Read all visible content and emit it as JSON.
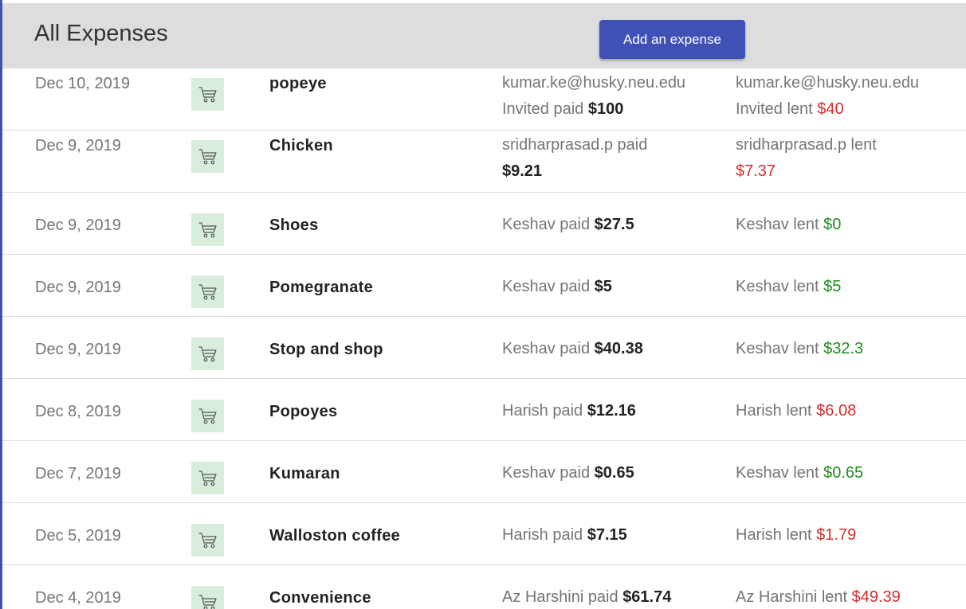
{
  "header": {
    "title": "All Expenses",
    "add_button_label": "Add an expense"
  },
  "colors": {
    "accent": "#3f51b5",
    "header_bg": "#dddddd",
    "icon_bg": "#d9eddd",
    "negative": "#d32f2f",
    "positive": "#1e8e1e"
  },
  "expenses": [
    {
      "date": "Dec 10, 2019",
      "icon": "shopping-cart-icon",
      "description": "popeye",
      "paid_line1": "kumar.ke@husky.neu.edu",
      "paid_prefix": "Invited paid ",
      "paid_amount": "$100",
      "lent_line1": "kumar.ke@husky.neu.edu",
      "lent_prefix": "Invited lent ",
      "lent_amount": "$40",
      "lent_status": "negative"
    },
    {
      "date": "Dec 9, 2019",
      "icon": "shopping-cart-icon",
      "description": "Chicken",
      "paid_line1": "",
      "paid_prefix": "sridharprasad.p paid ",
      "paid_amount": "$9.21",
      "lent_line1": "",
      "lent_prefix": "sridharprasad.p lent ",
      "lent_amount": "$7.37",
      "lent_status": "negative"
    },
    {
      "date": "Dec 9, 2019",
      "icon": "shopping-cart-icon",
      "description": "Shoes",
      "paid_line1": "",
      "paid_prefix": "Keshav paid ",
      "paid_amount": "$27.5",
      "lent_line1": "",
      "lent_prefix": "Keshav lent ",
      "lent_amount": "$0",
      "lent_status": "positive"
    },
    {
      "date": "Dec 9, 2019",
      "icon": "shopping-cart-icon",
      "description": "Pomegranate",
      "paid_line1": "",
      "paid_prefix": "Keshav paid ",
      "paid_amount": "$5",
      "lent_line1": "",
      "lent_prefix": "Keshav lent ",
      "lent_amount": "$5",
      "lent_status": "positive"
    },
    {
      "date": "Dec 9, 2019",
      "icon": "shopping-cart-icon",
      "description": "Stop and shop",
      "paid_line1": "",
      "paid_prefix": "Keshav paid ",
      "paid_amount": "$40.38",
      "lent_line1": "",
      "lent_prefix": "Keshav lent ",
      "lent_amount": "$32.3",
      "lent_status": "positive"
    },
    {
      "date": "Dec 8, 2019",
      "icon": "shopping-cart-icon",
      "description": "Popoyes",
      "paid_line1": "",
      "paid_prefix": "Harish paid ",
      "paid_amount": "$12.16",
      "lent_line1": "",
      "lent_prefix": "Harish lent ",
      "lent_amount": "$6.08",
      "lent_status": "negative"
    },
    {
      "date": "Dec 7, 2019",
      "icon": "shopping-cart-icon",
      "description": "Kumaran",
      "paid_line1": "",
      "paid_prefix": "Keshav paid ",
      "paid_amount": "$0.65",
      "lent_line1": "",
      "lent_prefix": "Keshav lent ",
      "lent_amount": "$0.65",
      "lent_status": "positive"
    },
    {
      "date": "Dec 5, 2019",
      "icon": "shopping-cart-icon",
      "description": "Walloston coffee",
      "paid_line1": "",
      "paid_prefix": "Harish paid ",
      "paid_amount": "$7.15",
      "lent_line1": "",
      "lent_prefix": "Harish lent ",
      "lent_amount": "$1.79",
      "lent_status": "negative"
    },
    {
      "date": "Dec 4, 2019",
      "icon": "shopping-cart-icon",
      "description": "Convenience",
      "paid_line1": "",
      "paid_prefix": "Az Harshini paid ",
      "paid_amount": "$61.74",
      "lent_line1": "",
      "lent_prefix": "Az Harshini lent ",
      "lent_amount": "$49.39",
      "lent_status": "negative"
    }
  ]
}
